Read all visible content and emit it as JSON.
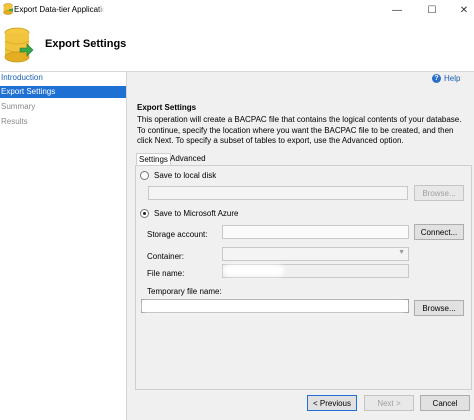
{
  "window": {
    "title": "Export Data-tier Application",
    "minimize_glyph": "—",
    "maximize_glyph": "☐",
    "close_glyph": "✕"
  },
  "header": {
    "title": "Export Settings",
    "icon": "database-export-icon"
  },
  "nav": {
    "items": [
      {
        "label": "Introduction",
        "state": "link"
      },
      {
        "label": "Export Settings",
        "state": "selected"
      },
      {
        "label": "Summary",
        "state": "disabled"
      },
      {
        "label": "Results",
        "state": "disabled"
      }
    ]
  },
  "help": {
    "label": "Help"
  },
  "content": {
    "section_title": "Export Settings",
    "description": "This operation will create a BACPAC file that contains the logical contents of your database. To continue, specify the location where you want the BACPAC file to be created, and then click Next. To specify a subset of tables to export, use the Advanced option."
  },
  "tabs": [
    {
      "label": "Settings",
      "selected": true
    },
    {
      "label": "Advanced",
      "selected": false
    }
  ],
  "options": {
    "local": {
      "label": "Save to local disk",
      "checked": false,
      "path_value": "",
      "browse_label": "Browse..."
    },
    "azure": {
      "label": "Save to Microsoft Azure",
      "checked": true,
      "storage_label": "Storage account:",
      "storage_value": "",
      "connect_label": "Connect...",
      "container_label": "Container:",
      "container_value": "",
      "filename_label": "File name:",
      "temp_label": "Temporary file name:",
      "browse_label": "Browse..."
    }
  },
  "footer": {
    "previous_label": "< Previous",
    "next_label": "Next >",
    "cancel_label": "Cancel"
  },
  "colors": {
    "accent": "#1e70d2",
    "link": "#1a5fb4",
    "panel_bg": "#f0f0f0"
  }
}
